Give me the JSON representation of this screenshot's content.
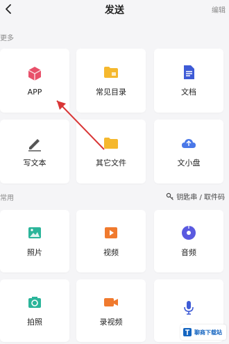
{
  "header": {
    "title": "发送",
    "edit_label": "编辑"
  },
  "sections": {
    "more_label": "更多",
    "common_label": "常用"
  },
  "keys_label": "钥匙串 / 取件码",
  "more_items": [
    {
      "label": "APP",
      "icon": "app-cube-icon"
    },
    {
      "label": "常见目录",
      "icon": "folder-icon"
    },
    {
      "label": "文档",
      "icon": "document-icon"
    },
    {
      "label": "写文本",
      "icon": "pencil-icon"
    },
    {
      "label": "其它文件",
      "icon": "folder-icon"
    },
    {
      "label": "文小盘",
      "icon": "cloud-icon"
    }
  ],
  "common_items": [
    {
      "label": "照片",
      "icon": "photo-icon"
    },
    {
      "label": "视频",
      "icon": "video-icon"
    },
    {
      "label": "音频",
      "icon": "audio-icon"
    },
    {
      "label": "拍照",
      "icon": "camera-icon"
    },
    {
      "label": "录视频",
      "icon": "record-video-icon"
    },
    {
      "label": "",
      "icon": "microphone-icon"
    }
  ],
  "watermark_text": "聊商下载站",
  "colors": {
    "app": "#e8506a",
    "folder": "#f5b82e",
    "document": "#3e5bd6",
    "pencil": "#555555",
    "cloud": "#4a78e8",
    "photo": "#2bb59a",
    "video": "#f07a2e",
    "audio": "#5a5ae0",
    "camera": "#2bb59a",
    "record": "#f07a2e",
    "mic": "#3e5bd6",
    "arrow": "#d93636"
  }
}
